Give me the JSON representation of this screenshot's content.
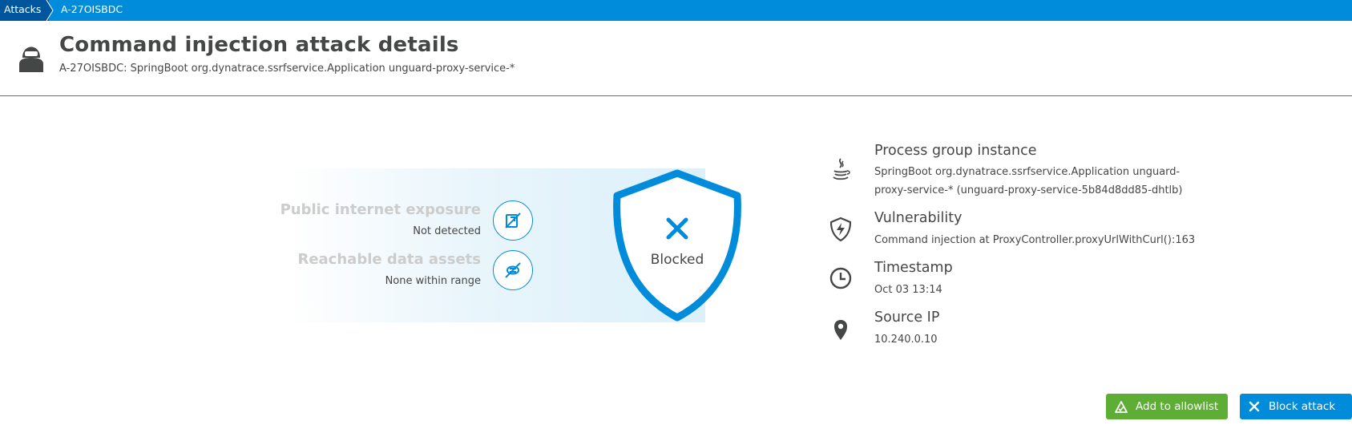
{
  "breadcrumb": {
    "items": [
      "Attacks",
      "A-27OISBDC"
    ]
  },
  "header": {
    "title": "Command injection attack details",
    "subtitle": "A-27OISBDC: SpringBoot org.dynatrace.ssrfservice.Application unguard-proxy-service-*",
    "icon": "attacker-icon"
  },
  "exposure": {
    "public_internet": {
      "title": "Public internet exposure",
      "value": "Not detected",
      "icon": "no-internet-icon"
    },
    "data_assets": {
      "title": "Reachable data assets",
      "value": "None within range",
      "icon": "no-data-assets-icon"
    }
  },
  "status": {
    "label": "Blocked",
    "icon": "close-icon"
  },
  "details": [
    {
      "title": "Process group instance",
      "lines": [
        "SpringBoot org.dynatrace.ssrfservice.Application unguard-",
        "proxy-service-* (unguard-proxy-service-5b84d8dd85-dhtlb)"
      ],
      "icon": "java-icon"
    },
    {
      "title": "Vulnerability",
      "lines": [
        "Command injection at ProxyController.proxyUrlWithCurl():163"
      ],
      "icon": "shield-bolt-icon"
    },
    {
      "title": "Timestamp",
      "lines": [
        "Oct 03 13:14"
      ],
      "icon": "clock-icon"
    },
    {
      "title": "Source IP",
      "lines": [
        "10.240.0.10"
      ],
      "icon": "location-pin-icon"
    }
  ],
  "actions": {
    "allowlist_label": "Add to allowlist",
    "block_label": "Block attack"
  },
  "colors": {
    "brand_blue": "#008cdb",
    "breadcrumb_dark": "#00569d",
    "allow_green": "#5ead35",
    "text": "#454646",
    "muted_text": "#cccccc"
  }
}
